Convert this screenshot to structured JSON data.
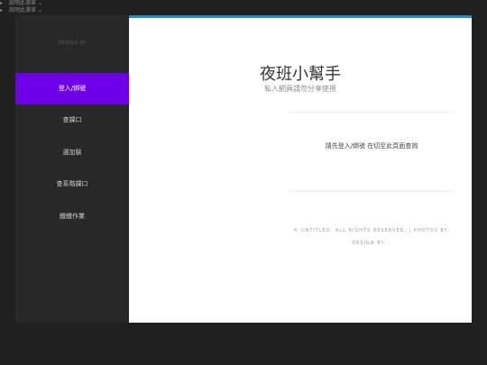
{
  "breadcrumb": {
    "line1": "說明此選單",
    "line2": "說明此選單"
  },
  "sidebar": {
    "logo": "DESIGN BY",
    "items": [
      {
        "label": "登入/綁號",
        "active": true
      },
      {
        "label": "查課口"
      },
      {
        "label": "選加裝"
      },
      {
        "label": "查系階課口"
      },
      {
        "label": "繳繳作業"
      }
    ]
  },
  "main": {
    "title": "夜班小幫手",
    "subtitle": "私人網頁請勿分享使用",
    "notice": "請先登入/綁號 在切至此頁面查詢",
    "footer_line1": "© UNTITLED. ALL RIGHTS RESERVED. | PHOTOS BY:",
    "footer_line2": "DESIGN BY: ."
  },
  "colors": {
    "accent": "#6e00e8",
    "top_border": "#2a8cbf",
    "background": "#202020",
    "sidebar": "#282828"
  }
}
